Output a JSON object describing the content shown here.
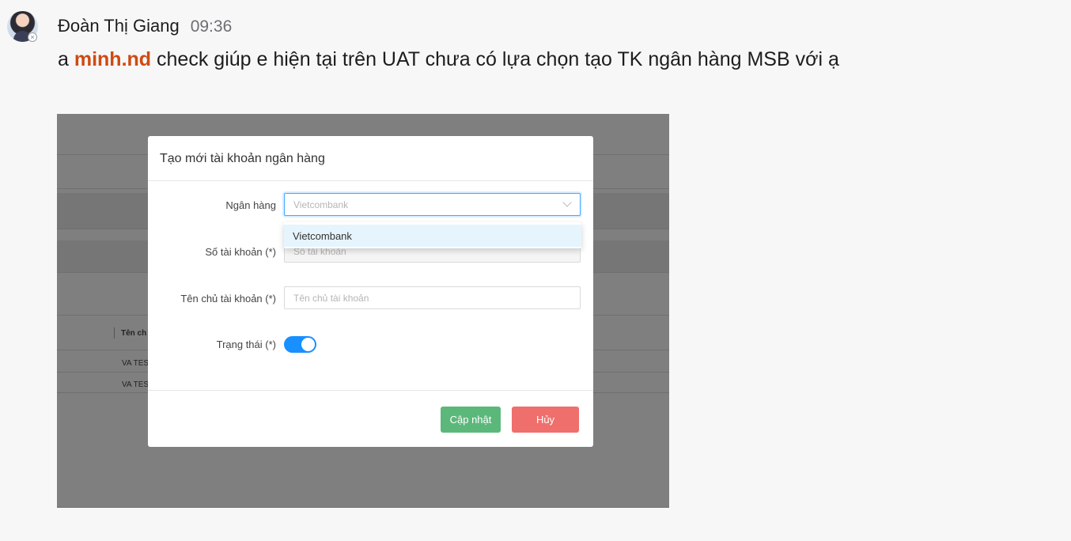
{
  "message": {
    "sender": "Đoàn Thị Giang",
    "time": "09:36",
    "text_prefix": "a",
    "mention": "minh.nd",
    "text_suffix": "check giúp e hiện tại trên UAT chưa có lựa chọn tạo TK ngân hàng MSB với ạ"
  },
  "screenshot": {
    "background_rows": [
      "Tên ch",
      "VA TES",
      "VA TES"
    ],
    "modal": {
      "title": "Tạo mới tài khoản ngân hàng",
      "fields": {
        "bank_label": "Ngân hàng",
        "bank_placeholder": "Vietcombank",
        "account_number_label": "Số tài khoản (*)",
        "account_number_placeholder": "Số tài khoản",
        "account_holder_label": "Tên chủ tài khoản (*)",
        "account_holder_placeholder": "Tên chủ tài khoản",
        "status_label": "Trạng thái (*)",
        "status_on": true
      },
      "dropdown_options": [
        "Vietcombank"
      ],
      "buttons": {
        "update": "Cập nhật",
        "cancel": "Hủy"
      }
    }
  },
  "colors": {
    "mention": "#cf4b12",
    "update_button": "#5cb87a",
    "cancel_button": "#ef6f6c",
    "toggle": "#1890ff"
  }
}
